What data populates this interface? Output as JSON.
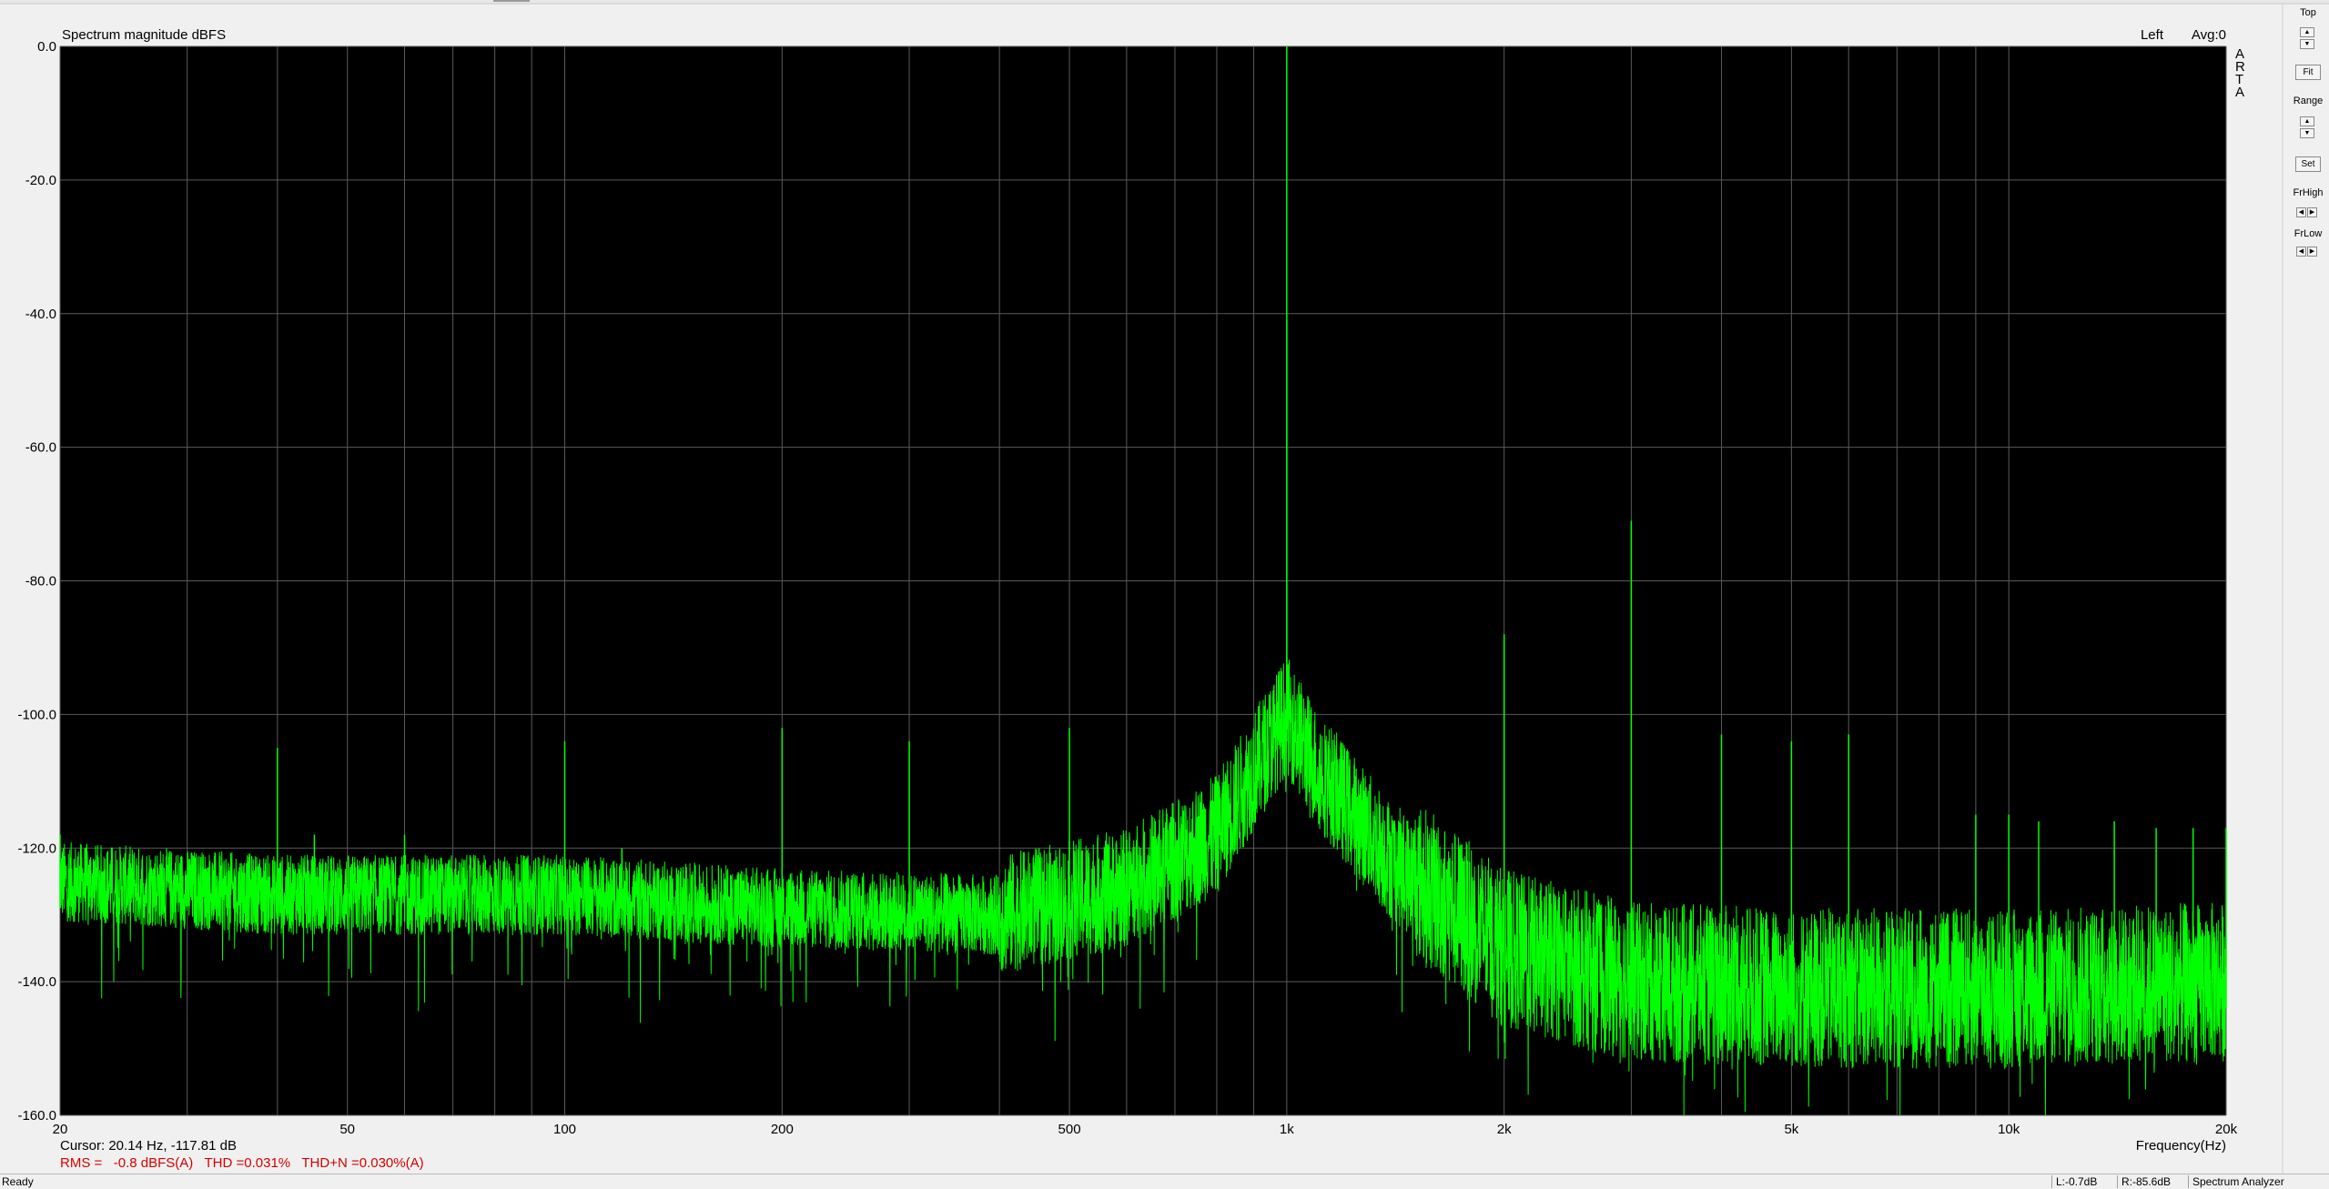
{
  "chart_data": {
    "type": "line",
    "title": "Spectrum magnitude dBFS",
    "channel_label": "Left",
    "avg_label": "Avg:0",
    "brand_letters": [
      "A",
      "R",
      "T",
      "A"
    ],
    "xlabel": "Frequency(Hz)",
    "ylabel": "",
    "xscale": "log",
    "xlim": [
      20,
      20000
    ],
    "ylim": [
      -160,
      0
    ],
    "grid": true,
    "y_ticks": [
      "0.0",
      "-20.0",
      "-40.0",
      "-60.0",
      "-80.0",
      "-100.0",
      "-120.0",
      "-140.0",
      "-160.0"
    ],
    "y_tick_values": [
      0,
      -20,
      -40,
      -60,
      -80,
      -100,
      -120,
      -140,
      -160
    ],
    "x_tick_labels": [
      "20",
      "50",
      "100",
      "200",
      "500",
      "1k",
      "2k",
      "5k",
      "10k",
      "20k"
    ],
    "x_tick_values": [
      20,
      50,
      100,
      200,
      500,
      1000,
      2000,
      5000,
      10000,
      20000
    ],
    "series": [
      {
        "color": "#00ff00",
        "noise_floor": [
          [
            20,
            -125
          ],
          [
            40,
            -127
          ],
          [
            100,
            -127
          ],
          [
            200,
            -129
          ],
          [
            400,
            -130
          ],
          [
            600,
            -126
          ],
          [
            800,
            -118
          ],
          [
            950,
            -104
          ],
          [
            1000,
            -100
          ],
          [
            1100,
            -108
          ],
          [
            1400,
            -122
          ],
          [
            2000,
            -135
          ],
          [
            3000,
            -140
          ],
          [
            5000,
            -141
          ],
          [
            10000,
            -141
          ],
          [
            20000,
            -140
          ]
        ],
        "peaks": [
          [
            20,
            -118
          ],
          [
            40,
            -105
          ],
          [
            45,
            -118
          ],
          [
            60,
            -118
          ],
          [
            100,
            -104
          ],
          [
            120,
            -120
          ],
          [
            200,
            -102
          ],
          [
            300,
            -104
          ],
          [
            500,
            -102
          ],
          [
            1000,
            0
          ],
          [
            1000,
            -41
          ],
          [
            2000,
            -88
          ],
          [
            3000,
            -71
          ],
          [
            4000,
            -103
          ],
          [
            5000,
            -104
          ],
          [
            6000,
            -103
          ],
          [
            9000,
            -115
          ],
          [
            10000,
            -115
          ],
          [
            11000,
            -116
          ],
          [
            14000,
            -116
          ],
          [
            16000,
            -117
          ],
          [
            18000,
            -117
          ],
          [
            20000,
            -117
          ]
        ]
      }
    ]
  },
  "cursor_readout": "Cursor: 20.14 Hz, -117.81 dB",
  "measurements": "RMS =   -0.8 dBFS(A)   THD =0.031%   THD+N =0.030%(A)",
  "side_panel": {
    "top_label": "Top",
    "fit_label": "Fit",
    "range_label": "Range",
    "set_label": "Set",
    "frhigh_label": "FrHigh",
    "frlow_label": "FrLow"
  },
  "status_bar": {
    "ready": "Ready",
    "left_level": "L:-0.7dB",
    "right_level": "R:-85.6dB",
    "mode": "Spectrum Analyzer"
  },
  "colors": {
    "plot_bg": "#000000",
    "trace": "#00ff00",
    "grid": "#5a5a5a",
    "measurement_text": "#d40000"
  }
}
